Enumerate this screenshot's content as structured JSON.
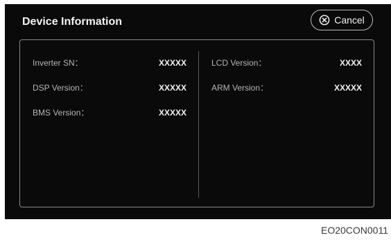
{
  "dialog": {
    "title": "Device Information",
    "cancel_label": "Cancel",
    "cancel_icon": "circle-x-icon"
  },
  "info": {
    "left": [
      {
        "label": "Inverter SN：",
        "value": "XXXXX"
      },
      {
        "label": "DSP Version：",
        "value": "XXXXX"
      },
      {
        "label": "BMS Version：",
        "value": "XXXXX"
      }
    ],
    "right": [
      {
        "label": "LCD Version：",
        "value": "XXXX"
      },
      {
        "label": "ARM Version：",
        "value": "XXXXX"
      }
    ]
  },
  "caption": "EO20CON0011"
}
